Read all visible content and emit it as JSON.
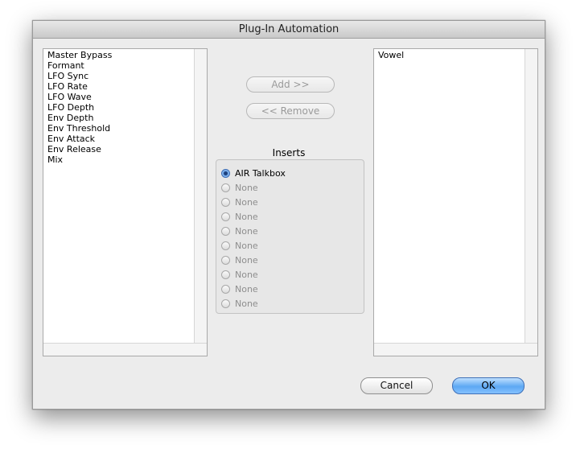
{
  "window": {
    "title": "Plug-In Automation"
  },
  "left_list": {
    "items": [
      "Master Bypass",
      "Formant",
      "LFO Sync",
      "LFO Rate",
      "LFO Wave",
      "LFO Depth",
      "Env Depth",
      "Env Threshold",
      "Env Attack",
      "Env Release",
      "Mix"
    ]
  },
  "right_list": {
    "items": [
      "Vowel"
    ]
  },
  "buttons": {
    "add": "Add >>",
    "remove": "<< Remove",
    "cancel": "Cancel",
    "ok": "OK"
  },
  "inserts": {
    "label": "Inserts",
    "options": [
      {
        "label": "AIR Talkbox",
        "selected": true,
        "enabled": true
      },
      {
        "label": "None",
        "selected": false,
        "enabled": false
      },
      {
        "label": "None",
        "selected": false,
        "enabled": false
      },
      {
        "label": "None",
        "selected": false,
        "enabled": false
      },
      {
        "label": "None",
        "selected": false,
        "enabled": false
      },
      {
        "label": "None",
        "selected": false,
        "enabled": false
      },
      {
        "label": "None",
        "selected": false,
        "enabled": false
      },
      {
        "label": "None",
        "selected": false,
        "enabled": false
      },
      {
        "label": "None",
        "selected": false,
        "enabled": false
      },
      {
        "label": "None",
        "selected": false,
        "enabled": false
      }
    ]
  },
  "colors": {
    "ok_button": "#5da8f3",
    "window_bg": "#ececec"
  }
}
